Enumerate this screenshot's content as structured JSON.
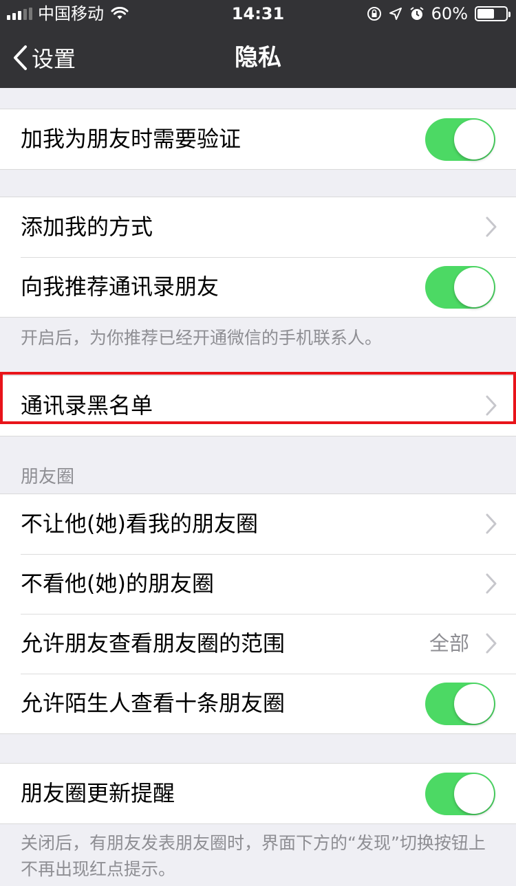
{
  "status_bar": {
    "carrier": "中国移动",
    "time": "14:31",
    "battery_percent": "60%",
    "battery_level": 0.6
  },
  "nav": {
    "back_label": "设置",
    "title": "隐私"
  },
  "groups": {
    "verify": {
      "label": "加我为朋友时需要验证",
      "toggle_on": true
    },
    "add_methods": {
      "label": "添加我的方式"
    },
    "recommend": {
      "label": "向我推荐通讯录朋友",
      "toggle_on": true
    },
    "recommend_note": "开启后，为你推荐已经开通微信的手机联系人。",
    "blacklist": {
      "label": "通讯录黑名单"
    },
    "moments_section_title": "朋友圈",
    "moments": [
      {
        "label": "不让他(她)看我的朋友圈"
      },
      {
        "label": "不看他(她)的朋友圈"
      },
      {
        "label": "允许朋友查看朋友圈的范围",
        "value": "全部"
      },
      {
        "label": "允许陌生人查看十条朋友圈",
        "toggle_on": true
      }
    ],
    "moments_update": {
      "label": "朋友圈更新提醒",
      "toggle_on": true
    },
    "moments_update_note": "关闭后，有朋友发表朋友圈时，界面下方的“发现”切换按钮上不再出现红点提示。"
  },
  "colors": {
    "nav_background": "#333336",
    "toggle_on": "#4cd964",
    "highlight": "#e8141a",
    "page_background": "#efeff4"
  },
  "icons": [
    "signal-icon",
    "wifi-icon",
    "orientation-lock-icon",
    "location-icon",
    "alarm-icon",
    "battery-icon",
    "back-chevron-icon",
    "chevron-right-icon"
  ]
}
